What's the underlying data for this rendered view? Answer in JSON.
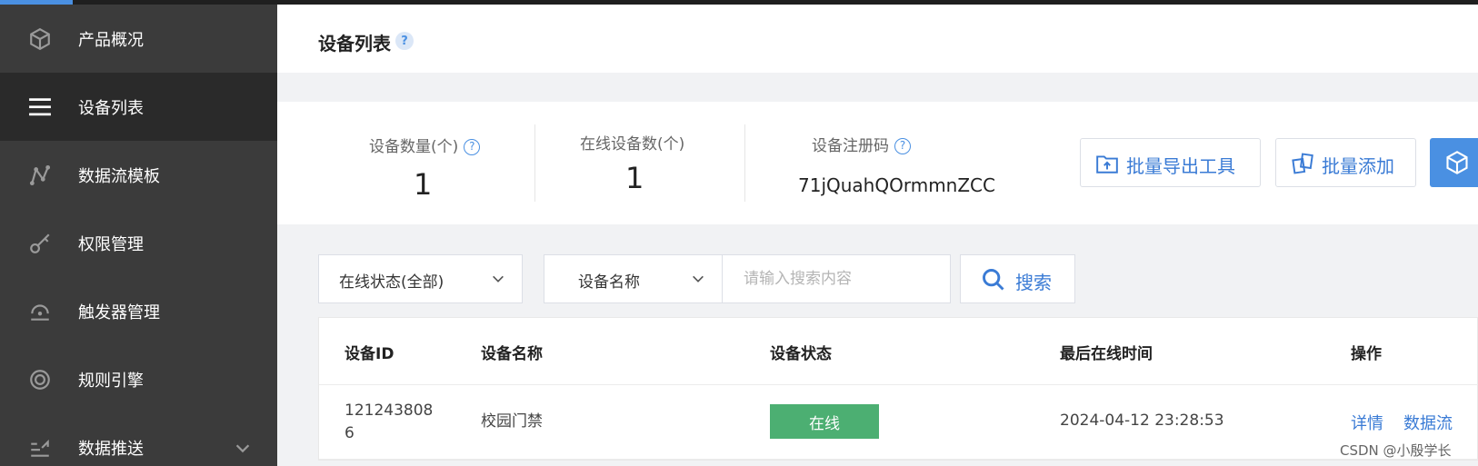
{
  "sidebar": {
    "items": [
      {
        "label": "产品概况",
        "icon": "cube-icon"
      },
      {
        "label": "设备列表",
        "icon": "list-icon",
        "active": true
      },
      {
        "label": "数据流模板",
        "icon": "node-flow-icon"
      },
      {
        "label": "权限管理",
        "icon": "key-icon"
      },
      {
        "label": "触发器管理",
        "icon": "trigger-icon"
      },
      {
        "label": "规则引擎",
        "icon": "target-icon"
      },
      {
        "label": "数据推送",
        "icon": "push-icon"
      }
    ]
  },
  "header": {
    "title": "设备列表",
    "help": "?"
  },
  "stats": {
    "device_count_label": "设备数量(个)",
    "device_count_value": "1",
    "online_count_label": "在线设备数(个)",
    "online_count_value": "1",
    "register_code_label": "设备注册码",
    "register_code_value": "71jQuahQOrmmnZCC",
    "qmark": "?"
  },
  "actions": {
    "export_tool": "批量导出工具",
    "batch_add": "批量添加"
  },
  "filters": {
    "status_select": "在线状态(全部)",
    "search_type": "设备名称",
    "search_placeholder": "请输入搜索内容",
    "search_button": "搜索"
  },
  "table": {
    "headers": {
      "id": "设备ID",
      "name": "设备名称",
      "status": "设备状态",
      "last_online": "最后在线时间",
      "ops": "操作"
    },
    "rows": [
      {
        "id": "1212438086",
        "name": "校园门禁",
        "status": "在线",
        "last_online": "2024-04-12 23:28:53",
        "op_detail": "详情",
        "op_stream": "数据流"
      }
    ]
  },
  "watermark": "CSDN @小殷学长",
  "colors": {
    "sidebar_bg": "#3b3b3b",
    "sidebar_active_bg": "#2a2a2a",
    "accent_blue": "#4a90e2",
    "link_blue": "#3a7bd5",
    "online_green": "#4caf72"
  }
}
